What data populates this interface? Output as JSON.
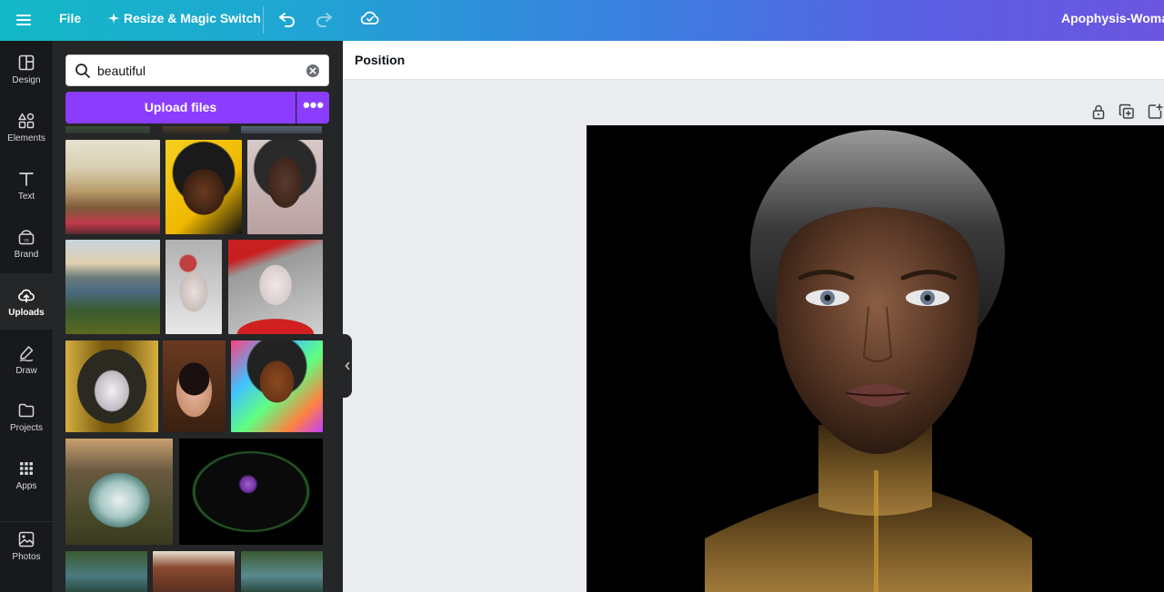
{
  "topbar": {
    "file_label": "File",
    "resize_label": "Resize & Magic Switch",
    "doc_title": "Apophysis-Woman"
  },
  "rail": {
    "items": [
      {
        "label": "Design",
        "icon": "layout-icon"
      },
      {
        "label": "Elements",
        "icon": "shapes-icon"
      },
      {
        "label": "Text",
        "icon": "text-icon"
      },
      {
        "label": "Brand",
        "icon": "brand-icon"
      },
      {
        "label": "Uploads",
        "icon": "cloud-upload-icon"
      },
      {
        "label": "Draw",
        "icon": "pen-icon"
      },
      {
        "label": "Projects",
        "icon": "folder-icon"
      },
      {
        "label": "Apps",
        "icon": "grid-icon"
      },
      {
        "label": "Photos",
        "icon": "photo-icon"
      }
    ],
    "active": "Uploads"
  },
  "panel": {
    "search_value": "beautiful",
    "upload_label": "Upload files",
    "more_label": "•••"
  },
  "canvas": {
    "position_label": "Position"
  },
  "colors": {
    "accent": "#8b3dff",
    "rail_bg": "#18191b",
    "panel_bg": "#252627"
  }
}
